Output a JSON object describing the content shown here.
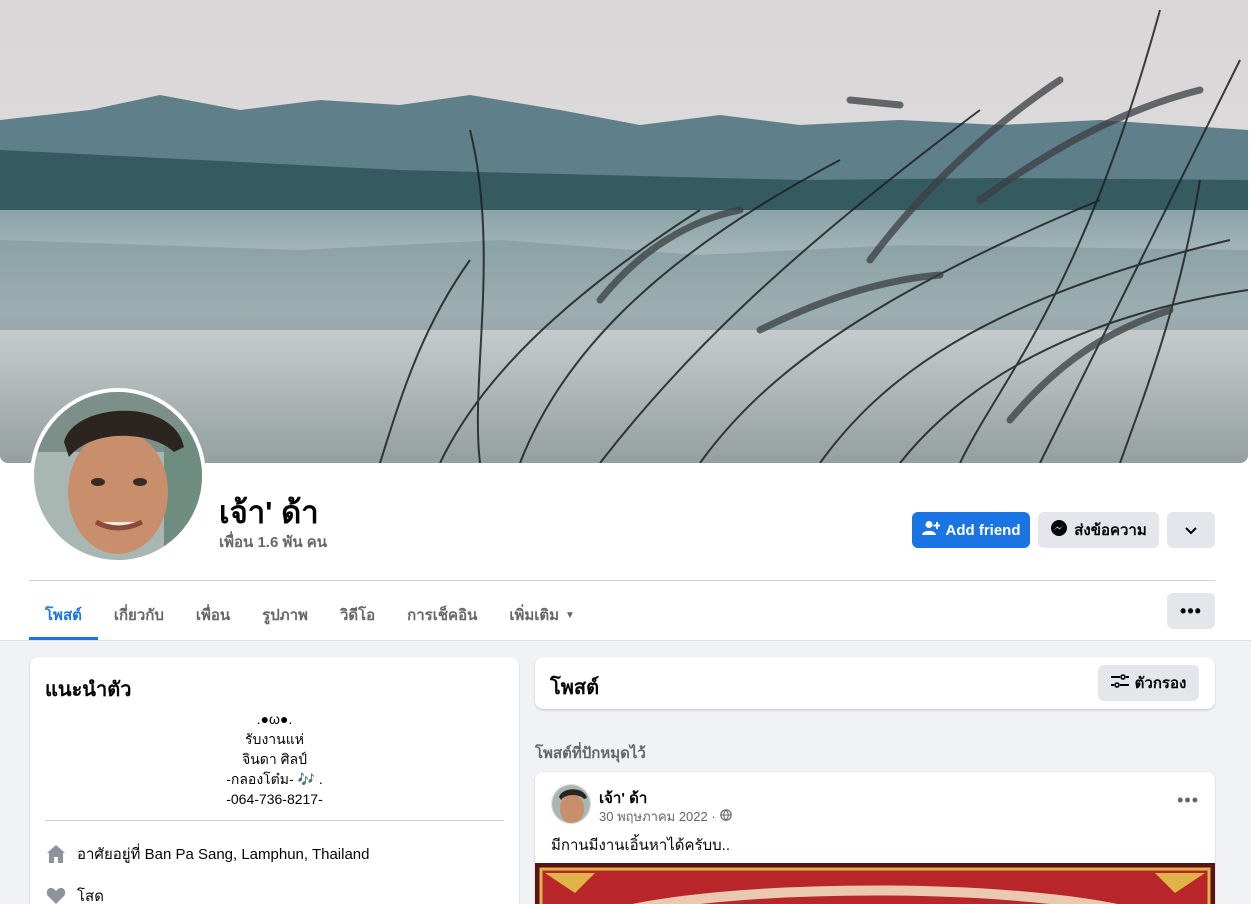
{
  "profile": {
    "name": "เจ้า' ด้า",
    "friends": "เพื่อน 1.6 พัน คน"
  },
  "actions": {
    "add_friend": "Add friend",
    "message": "ส่งข้อความ"
  },
  "tabs": [
    {
      "label": "โพสต์",
      "active": true
    },
    {
      "label": "เกี่ยวกับ"
    },
    {
      "label": "เพื่อน"
    },
    {
      "label": "รูปภาพ"
    },
    {
      "label": "วิดีโอ"
    },
    {
      "label": "การเช็คอิน"
    },
    {
      "label": "เพิ่มเติม"
    }
  ],
  "intro": {
    "title": "แนะนำตัว",
    "bio": [
      ".●ω●.",
      "รับงานแห่",
      "จินดา ศิลป์",
      "-กลองโต๋ม- 🎶 .",
      "-064-736-8217-"
    ],
    "lives_in": "อาศัยอยู่ที่ Ban Pa Sang, Lamphun, Thailand",
    "relationship": "โสด"
  },
  "posts": {
    "title": "โพสต์",
    "filter_label": "ตัวกรอง",
    "pinned_label": "โพสต์ที่ปักหมุดไว้",
    "pinned": {
      "author": "เจ้า' ด้า",
      "date": "30 พฤษภาคม 2022 ·",
      "text": "มีกานมีงานเอิ้นหาได้ครับบ.."
    }
  },
  "colors": {
    "primary": "#1b74e4",
    "secondary_btn": "#e4e6eb",
    "page_bg": "#f0f2f5"
  }
}
